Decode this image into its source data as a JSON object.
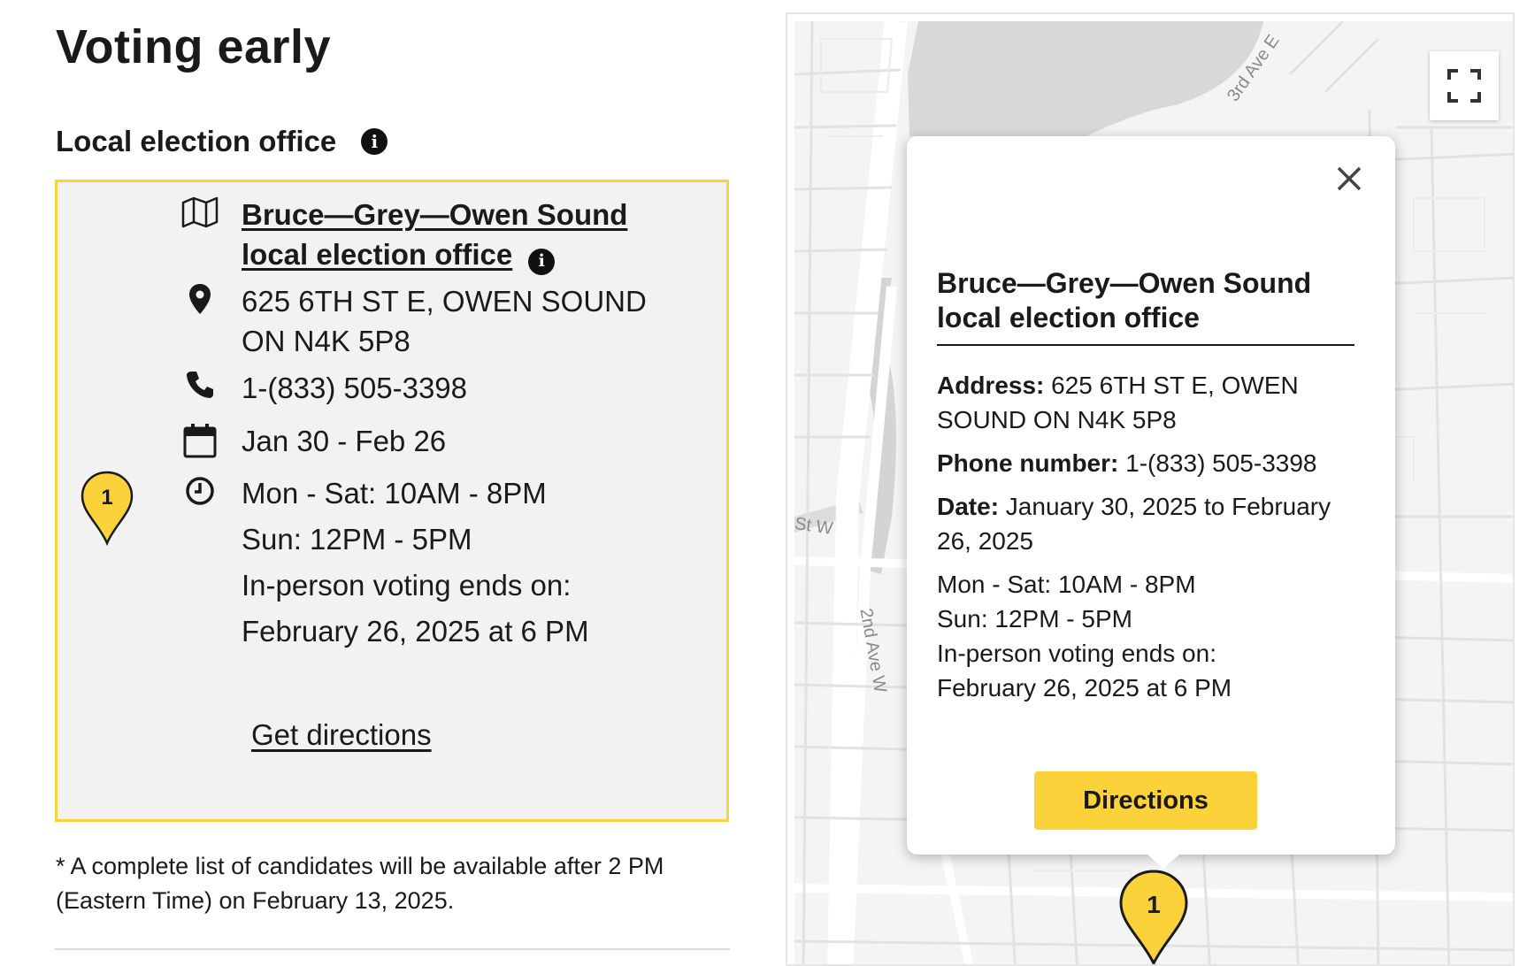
{
  "page": {
    "title": "Voting early",
    "section_heading": "Local election office"
  },
  "office_card": {
    "marker_number": "1",
    "office_name": "Bruce—Grey—Owen Sound local election office",
    "address_line1": "625 6TH ST E, OWEN SOUND",
    "address_line2": "ON N4K 5P8",
    "phone": "1-(833) 505-3398",
    "dates": "Jan 30 - Feb 26",
    "hours": [
      "Mon - Sat: 10AM - 8PM",
      "Sun: 12PM - 5PM",
      "In-person voting ends on:",
      "February 26, 2025 at 6 PM"
    ],
    "directions_link": "Get directions"
  },
  "footnote": "* A complete list of candidates will be available after 2 PM (Eastern Time) on February 13, 2025.",
  "map": {
    "street_labels": [
      "3rd Ave E",
      "St W",
      "2nd Ave W"
    ],
    "marker_number": "1",
    "popup": {
      "title": "Bruce—Grey—Owen Sound local election office",
      "address_label": "Address:",
      "address_value": "625 6TH ST E, OWEN SOUND ON N4K 5P8",
      "phone_label": "Phone number:",
      "phone_value": "1-(833) 505-3398",
      "date_label": "Date:",
      "date_value": "January 30, 2025 to February 26, 2025",
      "hours": [
        "Mon - Sat: 10AM - 8PM",
        "Sun: 12PM - 5PM",
        "In-person voting ends on:",
        "February 26, 2025 at 6 PM"
      ],
      "directions_button": "Directions"
    }
  },
  "colors": {
    "accent_yellow": "#fcd23a",
    "card_background": "#f2f2f2",
    "text": "#1a1a1a"
  },
  "icons": [
    "info-icon",
    "map-icon",
    "location-pin-icon",
    "phone-icon",
    "calendar-icon",
    "clock-icon",
    "fullscreen-icon",
    "close-icon",
    "map-marker-icon"
  ]
}
